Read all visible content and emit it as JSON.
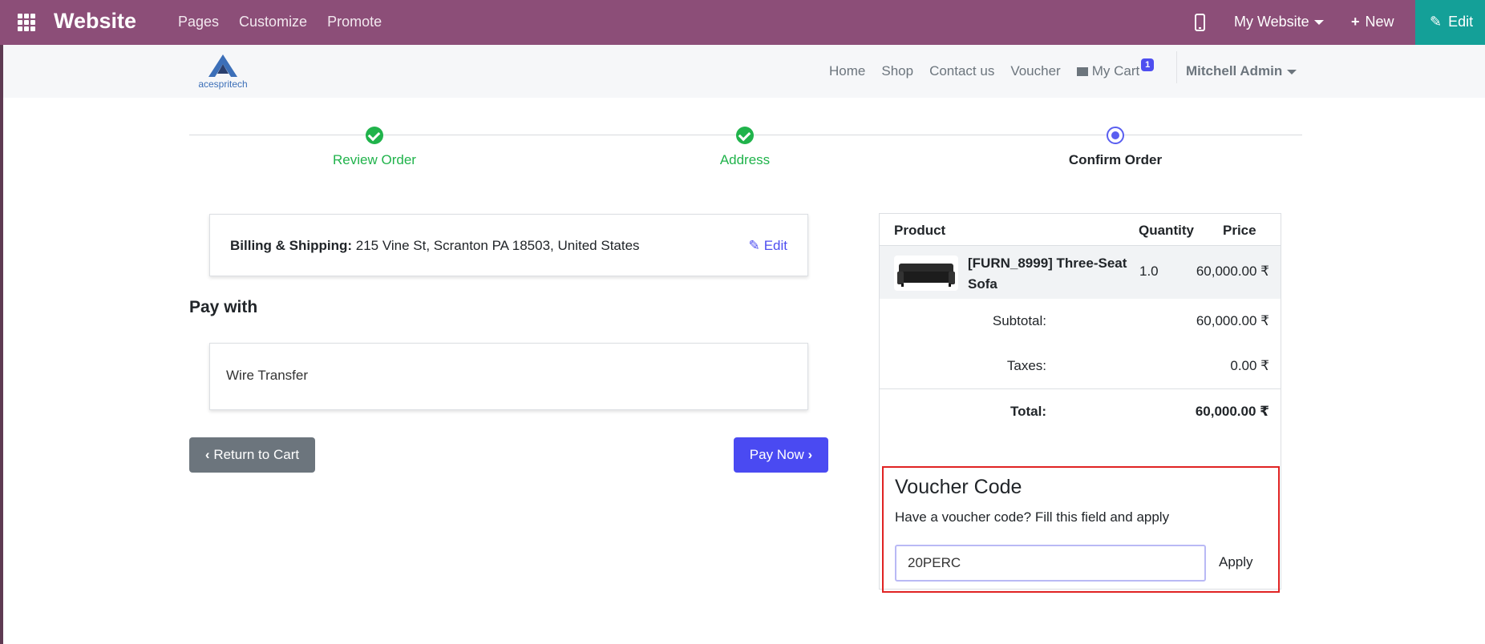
{
  "admin_bar": {
    "brand": "Website",
    "menu": [
      "Pages",
      "Customize",
      "Promote"
    ],
    "website_selector": "My Website",
    "new_label": "New",
    "edit_label": "Edit",
    "background_color": "#8c4e78",
    "edit_color": "#14a098"
  },
  "header": {
    "logo_text": "acespritech",
    "nav": [
      "Home",
      "Shop",
      "Contact us",
      "Voucher"
    ],
    "cart_label": "My Cart",
    "cart_count": "1",
    "user": "Mitchell Admin"
  },
  "wizard": {
    "steps": [
      {
        "label": "Review Order",
        "state": "done"
      },
      {
        "label": "Address",
        "state": "done"
      },
      {
        "label": "Confirm Order",
        "state": "current"
      }
    ]
  },
  "billing": {
    "label": "Billing & Shipping:",
    "address": "215 Vine St, Scranton PA 18503, United States",
    "edit_label": "Edit"
  },
  "payment": {
    "heading": "Pay with",
    "method": "Wire Transfer"
  },
  "buttons": {
    "return_to_cart": "Return to Cart",
    "pay_now": "Pay Now"
  },
  "summary": {
    "headers": {
      "product": "Product",
      "quantity": "Quantity",
      "price": "Price"
    },
    "items": [
      {
        "name": "[FURN_8999] Three-Seat Sofa",
        "quantity": "1.0",
        "price": "60,000.00 ₹"
      }
    ],
    "subtotal_label": "Subtotal:",
    "subtotal": "60,000.00 ₹",
    "taxes_label": "Taxes:",
    "taxes": "0.00 ₹",
    "total_label": "Total:",
    "total": "60,000.00 ₹"
  },
  "voucher": {
    "title": "Voucher Code",
    "description": "Have a voucher code? Fill this field and apply",
    "code": "20PERC",
    "apply_label": "Apply",
    "highlight_color": "#e02323"
  }
}
